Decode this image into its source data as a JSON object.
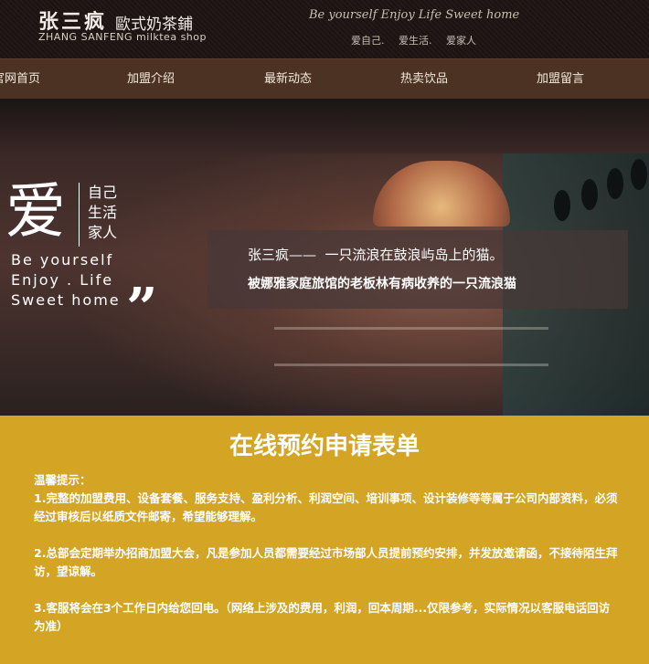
{
  "header": {
    "logo_cn": "张三疯",
    "logo_sub": "歐式奶茶鋪",
    "logo_en": "ZHANG SANFENG milktea shop",
    "slogan_en": "Be yourself Enjoy Life Sweet home",
    "slogan_cn": "爱自己. 爱生活. 爱家人"
  },
  "nav": {
    "items": [
      "官网首页",
      "加盟介绍",
      "最新动态",
      "热卖饮品",
      "加盟留言"
    ]
  },
  "hero": {
    "love_char": "爱",
    "love_lines": [
      "自己",
      "生活",
      "家人"
    ],
    "en_lines": [
      "Be yourself",
      "Enjoy . Life",
      "Sweet home"
    ],
    "quote": "”",
    "caption_line1": "张三疯——  一只流浪在鼓浪屿岛上的猫。",
    "caption_line2": "被娜雅家庭旅馆的老板林有病收养的一只流浪猫"
  },
  "form": {
    "title": "在线预约申请表单",
    "notice_heading": "温馨提示：",
    "notice_items": [
      "1.完整的加盟费用、设备套餐、服务支持、盈利分析、利润空间、培训事项、设计装修等等属于公司内部资料，必须经过审核后以纸质文件邮寄，希望能够理解。",
      "2.总部会定期举办招商加盟大会，凡是参加人员都需要经过市场部人员提前预约安排，并发放邀请函，不接待陌生拜访，望谅解。",
      "3.客服将会在3个工作日内给您回电。（网络上涉及的费用，利润，回本周期...仅限参考，实际情况以客服电话回访为准）"
    ]
  },
  "colors": {
    "header_bg": "#1c1212",
    "nav_bg": "#4b3222",
    "form_bg": "#d4a424"
  }
}
